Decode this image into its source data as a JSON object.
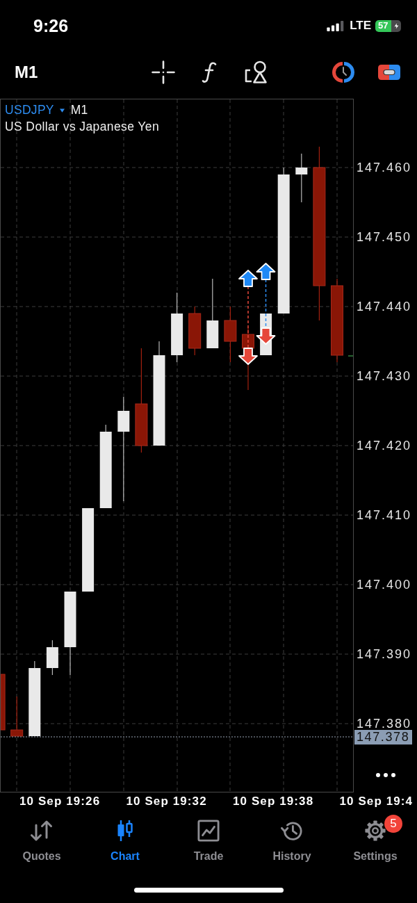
{
  "status_bar": {
    "time": "9:26",
    "network": "LTE",
    "battery": "57"
  },
  "toolbar": {
    "timeframe": "M1"
  },
  "chart": {
    "symbol": "USDJPY",
    "timeframe": "M1",
    "description": "US Dollar vs Japanese Yen",
    "price_labels": [
      "147.460",
      "147.450",
      "147.440",
      "147.430",
      "147.420",
      "147.410",
      "147.400",
      "147.390",
      "147.380"
    ],
    "current_price": "147.378",
    "time_labels": [
      "10 Sep 19:26",
      "10 Sep 19:32",
      "10 Sep 19:38",
      "10 Sep 19:4"
    ]
  },
  "tab_bar": {
    "tabs": [
      {
        "label": "Quotes",
        "selected": false
      },
      {
        "label": "Chart",
        "selected": true
      },
      {
        "label": "Trade",
        "selected": false
      },
      {
        "label": "History",
        "selected": false
      },
      {
        "label": "Settings",
        "selected": false,
        "badge": "5"
      }
    ]
  }
}
